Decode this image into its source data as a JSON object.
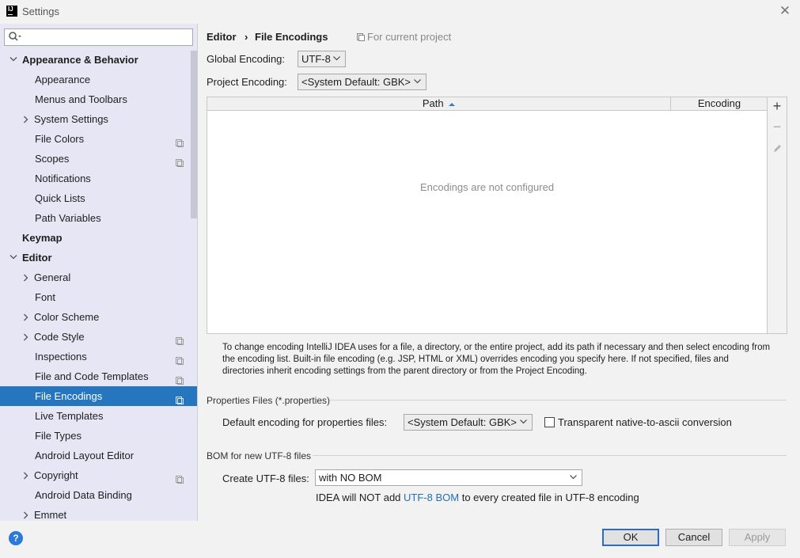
{
  "window": {
    "title": "Settings"
  },
  "sidebar": {
    "search_placeholder": "",
    "items": [
      {
        "label": "Appearance & Behavior",
        "bold": true,
        "arrow": "down",
        "indent": 0,
        "project": false
      },
      {
        "label": "Appearance",
        "bold": false,
        "arrow": "",
        "indent": 1,
        "project": false
      },
      {
        "label": "Menus and Toolbars",
        "bold": false,
        "arrow": "",
        "indent": 1,
        "project": false
      },
      {
        "label": "System Settings",
        "bold": false,
        "arrow": "right",
        "indent": 1,
        "project": false
      },
      {
        "label": "File Colors",
        "bold": false,
        "arrow": "",
        "indent": 1,
        "project": true
      },
      {
        "label": "Scopes",
        "bold": false,
        "arrow": "",
        "indent": 1,
        "project": true
      },
      {
        "label": "Notifications",
        "bold": false,
        "arrow": "",
        "indent": 1,
        "project": false
      },
      {
        "label": "Quick Lists",
        "bold": false,
        "arrow": "",
        "indent": 1,
        "project": false
      },
      {
        "label": "Path Variables",
        "bold": false,
        "arrow": "",
        "indent": 1,
        "project": false
      },
      {
        "label": "Keymap",
        "bold": true,
        "arrow": "",
        "indent": 0,
        "project": false
      },
      {
        "label": "Editor",
        "bold": true,
        "arrow": "down",
        "indent": 0,
        "project": false
      },
      {
        "label": "General",
        "bold": false,
        "arrow": "right",
        "indent": 1,
        "project": false
      },
      {
        "label": "Font",
        "bold": false,
        "arrow": "",
        "indent": 1,
        "project": false
      },
      {
        "label": "Color Scheme",
        "bold": false,
        "arrow": "right",
        "indent": 1,
        "project": false
      },
      {
        "label": "Code Style",
        "bold": false,
        "arrow": "right",
        "indent": 1,
        "project": true
      },
      {
        "label": "Inspections",
        "bold": false,
        "arrow": "",
        "indent": 1,
        "project": true
      },
      {
        "label": "File and Code Templates",
        "bold": false,
        "arrow": "",
        "indent": 1,
        "project": true
      },
      {
        "label": "File Encodings",
        "bold": false,
        "arrow": "",
        "indent": 1,
        "project": true,
        "selected": true
      },
      {
        "label": "Live Templates",
        "bold": false,
        "arrow": "",
        "indent": 1,
        "project": false
      },
      {
        "label": "File Types",
        "bold": false,
        "arrow": "",
        "indent": 1,
        "project": false
      },
      {
        "label": "Android Layout Editor",
        "bold": false,
        "arrow": "",
        "indent": 1,
        "project": false
      },
      {
        "label": "Copyright",
        "bold": false,
        "arrow": "right",
        "indent": 1,
        "project": true
      },
      {
        "label": "Android Data Binding",
        "bold": false,
        "arrow": "",
        "indent": 1,
        "project": false
      },
      {
        "label": "Emmet",
        "bold": false,
        "arrow": "right",
        "indent": 1,
        "project": false
      }
    ]
  },
  "breadcrumb": {
    "parent": "Editor",
    "separator": "›",
    "current": "File Encodings",
    "scope": "For current project"
  },
  "global_encoding": {
    "label": "Global Encoding:",
    "value": "UTF-8"
  },
  "project_encoding": {
    "label": "Project Encoding:",
    "value": "<System Default: GBK>"
  },
  "table": {
    "col_path": "Path",
    "col_encoding": "Encoding",
    "empty_text": "Encodings are not configured"
  },
  "toolbar": {
    "add": "+",
    "remove": "−"
  },
  "info": {
    "line1": "To change encoding IntelliJ IDEA uses for a file, a directory, or the entire project, add its path if necessary and then select encoding from",
    "line2": "the encoding list. Built-in file encoding (e.g. JSP, HTML or XML) overrides encoding you specify here. If not specified, files and",
    "line3": "directories inherit encoding settings from the parent directory or from the Project Encoding."
  },
  "properties": {
    "section_title": "Properties Files (*.properties)",
    "default_label": "Default encoding for properties files:",
    "default_value": "<System Default: GBK>",
    "transparent_label": "Transparent native-to-ascii conversion",
    "transparent_checked": false
  },
  "bom": {
    "section_title": "BOM for new UTF-8 files",
    "create_label": "Create UTF-8 files:",
    "create_value": "with NO BOM",
    "note_prefix": "IDEA will NOT add ",
    "note_link": "UTF-8 BOM",
    "note_suffix": " to every created file in UTF-8 encoding"
  },
  "buttons": {
    "ok": "OK",
    "cancel": "Cancel",
    "apply": "Apply",
    "help": "?"
  },
  "colors": {
    "selection": "#2675bf",
    "sidebar_bg": "#e6e6f5",
    "link": "#2470b3"
  }
}
